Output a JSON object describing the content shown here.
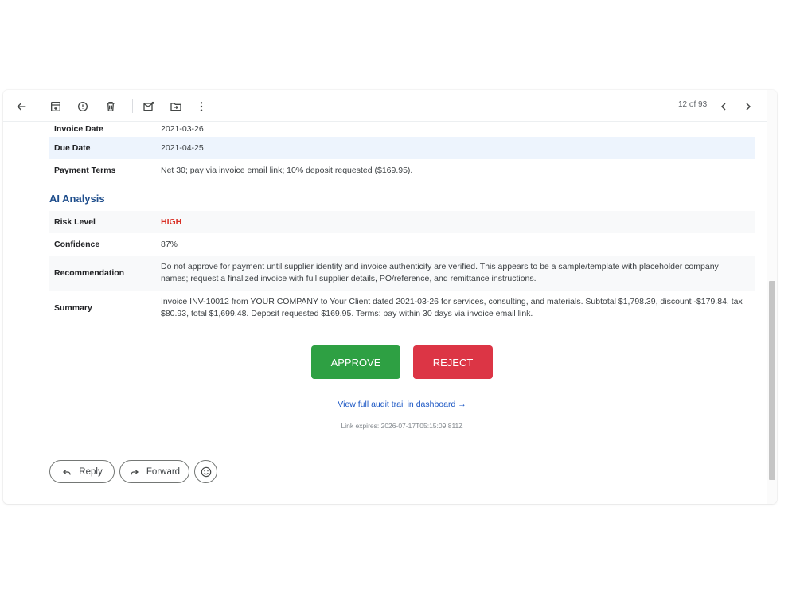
{
  "toolbar": {
    "icons": [
      "back-arrow-icon",
      "archive-icon",
      "report-spam-icon",
      "delete-icon",
      "mark-unread-icon",
      "move-to-icon",
      "more-icon"
    ],
    "pager_text": "12 of 93"
  },
  "details": [
    {
      "label": "Invoice Date",
      "value": "2021-03-26"
    },
    {
      "label": "Due Date",
      "value": "2021-04-25"
    },
    {
      "label": "Payment Terms",
      "value": "Net 30; pay via invoice email link; 10% deposit requested ($169.95)."
    }
  ],
  "analysis": {
    "title": "AI Analysis",
    "rows": [
      {
        "label": "Risk Level",
        "value": "HIGH"
      },
      {
        "label": "Confidence",
        "value": "87%"
      },
      {
        "label": "Recommendation",
        "value": "Do not approve for payment until supplier identity and invoice authenticity are verified. This appears to be a sample/template with placeholder company names; request a finalized invoice with full supplier details, PO/reference, and remittance instructions."
      },
      {
        "label": "Summary",
        "value": "Invoice INV-10012 from YOUR COMPANY to Your Client dated 2021-03-26 for services, consulting, and materials. Subtotal $1,798.39, discount -$179.84, tax $80.93, total $1,699.48. Deposit requested $169.95. Terms: pay within 30 days via invoice email link."
      }
    ]
  },
  "actions": {
    "approve_label": "APPROVE",
    "reject_label": "REJECT",
    "audit_link": "View full audit trail in dashboard →",
    "expires": "Link expires: 2026-07-17T05:15:09.811Z"
  },
  "footer": {
    "reply_label": "Reply",
    "forward_label": "Forward"
  },
  "colors": {
    "approve": "#2ea043",
    "reject": "#dc3545",
    "risk_high": "#d93025",
    "section_title": "#1f4e8c",
    "link": "#1a56c4"
  }
}
